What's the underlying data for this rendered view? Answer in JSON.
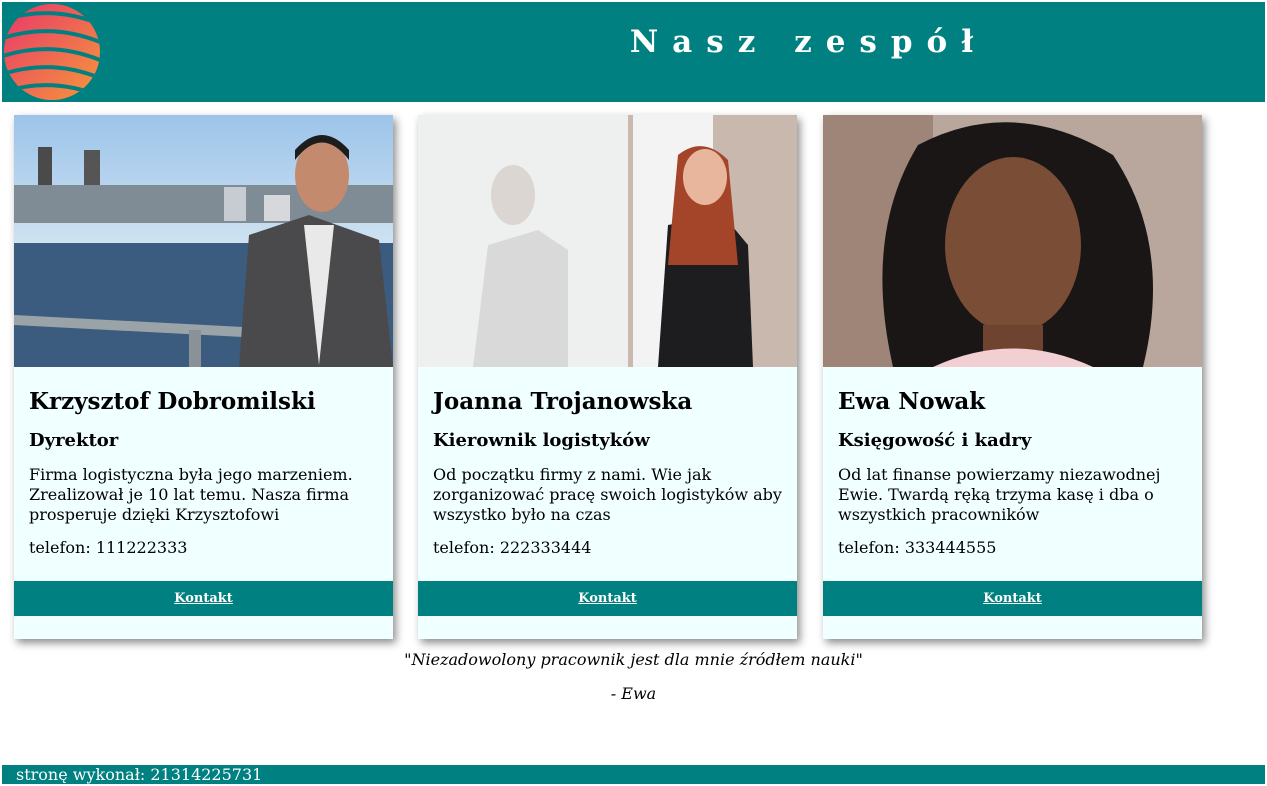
{
  "header": {
    "title": "Nasz zespół",
    "logo_icon": "globe-logo-icon",
    "colors": {
      "background": "#008080",
      "logo_gradient": [
        "#e8356b",
        "#f59a3a"
      ]
    }
  },
  "cards": [
    {
      "name": "Krzysztof Dobromilski",
      "role": "Dyrektor",
      "description": "Firma logistyczna była jego marzeniem. Zrealizował je 10 lat temu. Nasza firma prosperuje dzięki Krzysztofowi",
      "phone": "telefon: 111222333",
      "button": "Kontakt"
    },
    {
      "name": "Joanna Trojanowska",
      "role": "Kierownik logistyków",
      "description": "Od początku firmy z nami. Wie jak zorganizować pracę swoich logistyków aby wszystko było na czas",
      "phone": "telefon: 222333444",
      "button": "Kontakt"
    },
    {
      "name": "Ewa Nowak",
      "role": "Księgowość i kadry",
      "description": "Od lat finanse powierzamy niezawodnej Ewie. Twardą ręką trzyma kasę i dba o wszystkich pracowników",
      "phone": "telefon: 333444555",
      "button": "Kontakt"
    }
  ],
  "quote": {
    "text": "\"Niezadowolony pracownik jest dla mnie źródłem nauki\"",
    "author": "- Ewa"
  },
  "footer": {
    "text": "stronę wykonał: 21314225731"
  },
  "colors": {
    "accent": "#008080",
    "card_bg": "#f0ffff"
  }
}
